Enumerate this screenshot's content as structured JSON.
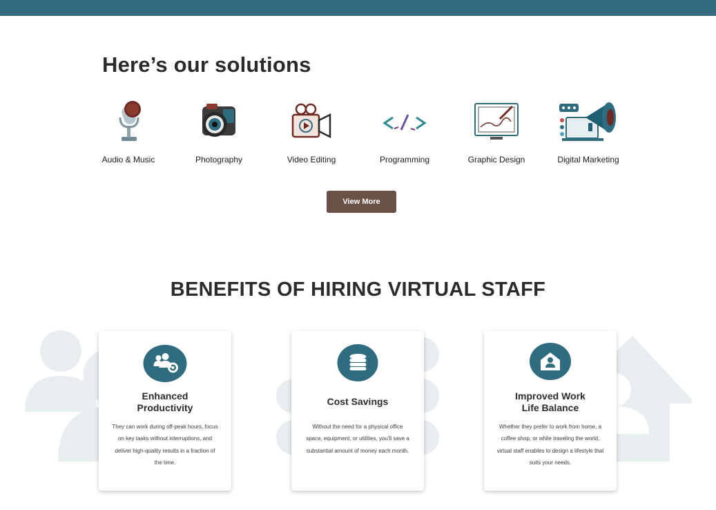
{
  "header": {
    "bar_color": "#346b82"
  },
  "solutions": {
    "title": "Here’s our solutions",
    "items": [
      {
        "label": "Audio & Music",
        "icon": "microphone-icon"
      },
      {
        "label": "Photography",
        "icon": "camera-icon"
      },
      {
        "label": "Video Editing",
        "icon": "video-camera-icon"
      },
      {
        "label": "Programming",
        "icon": "code-icon"
      },
      {
        "label": "Graphic Design",
        "icon": "design-monitor-icon"
      },
      {
        "label": "Digital Marketing",
        "icon": "megaphone-laptop-icon"
      }
    ],
    "view_more_label": "View More"
  },
  "benefits": {
    "title": "BENEFITS OF HIRING VIRTUAL STAFF",
    "cards": [
      {
        "title_line1": "Enhanced",
        "title_line2": "Productivity",
        "icon": "team-gear-icon",
        "text": "They can work during off-peak hours, focus on key tasks without interruptions, and deliver high-quality results in a fraction of the time."
      },
      {
        "title_line1": "Cost Savings",
        "title_line2": "",
        "icon": "coins-icon",
        "text": "Without the need for a physical office space, equipment, or utilities, you'll save a substantial amount of money each month."
      },
      {
        "title_line1": "Improved Work",
        "title_line2": "Life Balance",
        "icon": "home-user-icon",
        "text": "Whether they prefer to work from home, a coffee shop, or while traveling the world, virtual staff enables to design a lifestyle that suits your needs."
      }
    ]
  },
  "colors": {
    "accent": "#2f6c80",
    "button": "#6b5248",
    "watermark": "#e8edf0"
  }
}
